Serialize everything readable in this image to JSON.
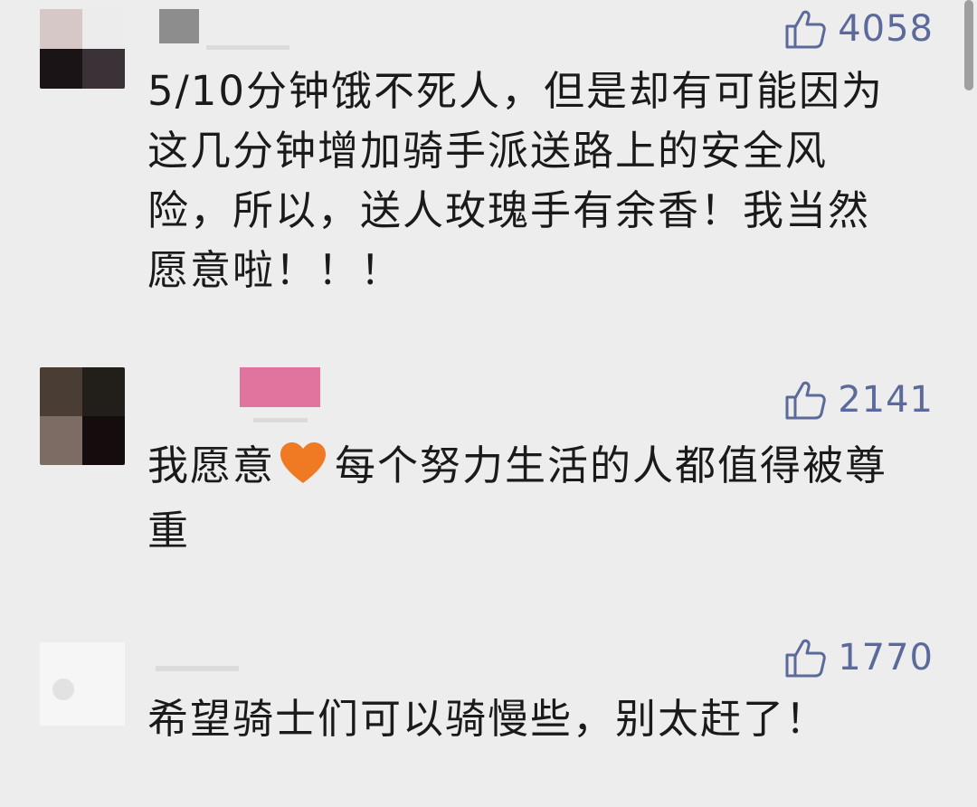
{
  "comments": [
    {
      "likes": "4058",
      "text": "5/10分钟饿不死人，但是却有可能因为这几分钟增加骑手派送路上的安全风险，所以，送人玫瑰手有余香！我当然愿意啦！！！"
    },
    {
      "likes": "2141",
      "text_before": "我愿意",
      "text_after": "每个努力生活的人都值得被尊重"
    },
    {
      "likes": "1770",
      "text": "希望骑士们可以骑慢些，别太赶了！"
    }
  ],
  "icons": {
    "like": "thumbs-up-icon",
    "emoji": "orange-heart-icon"
  },
  "colors": {
    "background": "#ededed",
    "like_color": "#5b6a9a",
    "heart": "#f07a24",
    "username_pink": "#e0749e"
  }
}
